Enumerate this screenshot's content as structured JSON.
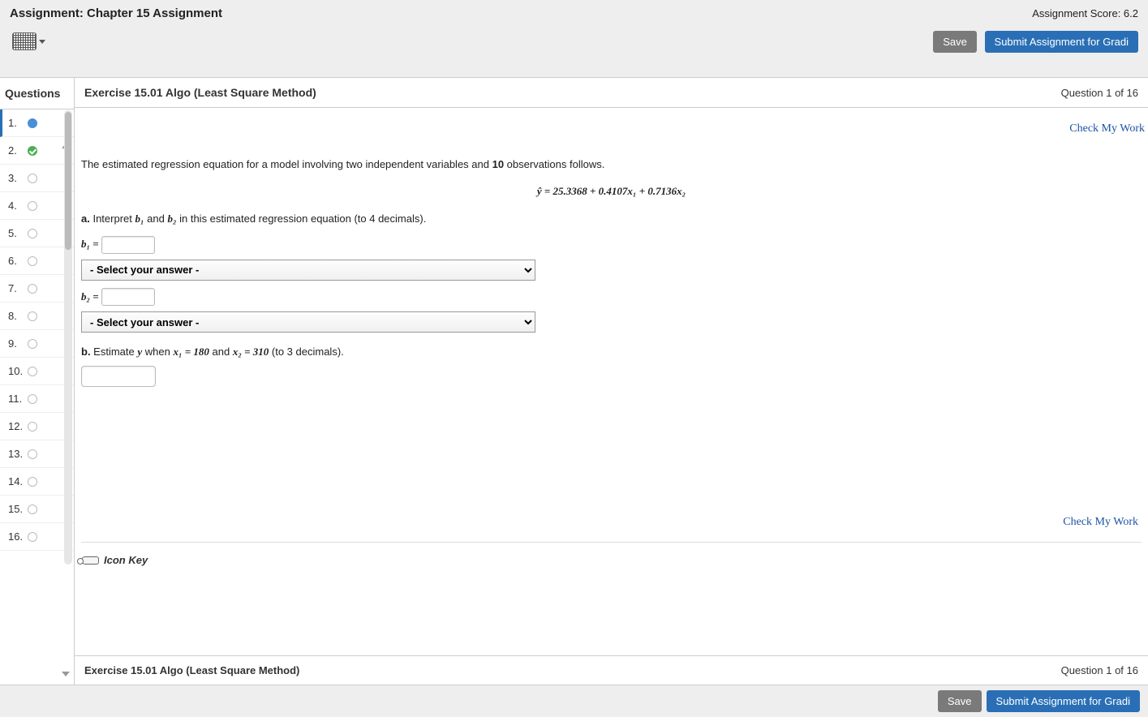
{
  "header": {
    "assignment_label": "Assignment:",
    "assignment_name": "Chapter 15 Assignment",
    "score_label": "Assignment Score: 6.2",
    "save": "Save",
    "submit": "Submit Assignment for Gradi"
  },
  "sidebar": {
    "title": "Questions",
    "items": [
      {
        "num": "1.",
        "status": "blue"
      },
      {
        "num": "2.",
        "status": "check"
      },
      {
        "num": "3.",
        "status": "empty"
      },
      {
        "num": "4.",
        "status": "empty"
      },
      {
        "num": "5.",
        "status": "empty"
      },
      {
        "num": "6.",
        "status": "empty"
      },
      {
        "num": "7.",
        "status": "empty"
      },
      {
        "num": "8.",
        "status": "empty"
      },
      {
        "num": "9.",
        "status": "empty"
      },
      {
        "num": "10.",
        "status": "empty"
      },
      {
        "num": "11.",
        "status": "empty"
      },
      {
        "num": "12.",
        "status": "empty"
      },
      {
        "num": "13.",
        "status": "empty"
      },
      {
        "num": "14.",
        "status": "empty"
      },
      {
        "num": "15.",
        "status": "empty"
      },
      {
        "num": "16.",
        "status": "empty"
      }
    ]
  },
  "content": {
    "exercise_title": "Exercise 15.01 Algo (Least Square Method)",
    "counter": "Question 1 of 16",
    "check_link": "Check My Work",
    "intro_a": "The estimated regression equation for a model involving two independent variables and ",
    "obs_count": "10",
    "intro_b": " observations follows.",
    "equation": "ŷ = 25.3368  +  0.4107x₁  +  0.7136x₂",
    "part_a_label": "a.",
    "part_a_text_1": " Interpret ",
    "b1": "b₁",
    "and": " and ",
    "b2": "b₂",
    "part_a_text_2": " in this estimated regression equation (to 4 decimals).",
    "b1_label": "b₁ =",
    "b2_label": "b₂ =",
    "select_placeholder": "- Select your answer -",
    "part_b_label": "b.",
    "part_b_text_1": " Estimate ",
    "y_var": "y",
    "when": " when ",
    "x1_eq": "x₁ = 180",
    "part_b_and": " and ",
    "x2_eq": "x₂ = 310",
    "part_b_tail": " (to 3 decimals).",
    "icon_key": "Icon Key",
    "footer_title": "Exercise 15.01 Algo (Least Square Method)",
    "footer_counter": "Question 1 of 16"
  },
  "bottom": {
    "save": "Save",
    "submit": "Submit Assignment for Gradi"
  }
}
